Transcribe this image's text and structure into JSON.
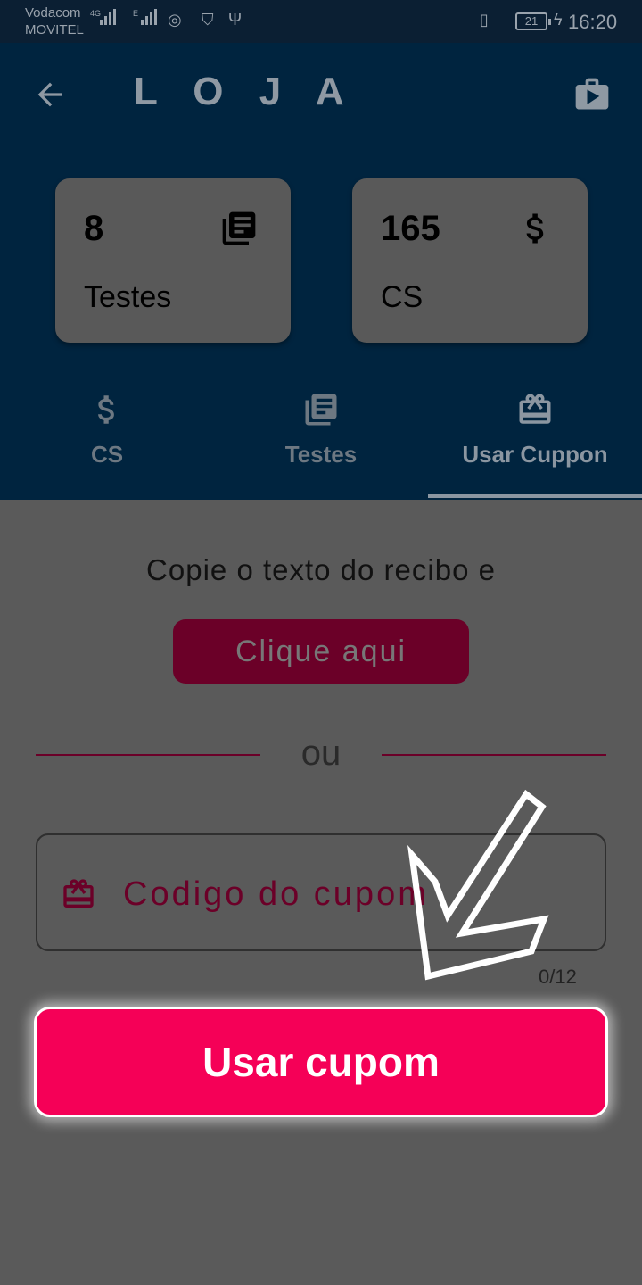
{
  "status_bar": {
    "carrier_1": "Vodacom",
    "carrier_2": "MOVITEL",
    "net_1": "4G",
    "net_2": "E",
    "battery": "21",
    "time": "16:20"
  },
  "header": {
    "title": "L O J A",
    "back_icon": "arrow-left-icon",
    "shop_icon": "shopping-bag-icon"
  },
  "cards": [
    {
      "value": "8",
      "label": "Testes",
      "icon": "library-books-icon"
    },
    {
      "value": "165",
      "label": "CS",
      "icon": "dollar-icon"
    }
  ],
  "tabs": [
    {
      "label": "CS",
      "icon": "dollar-icon",
      "active": false
    },
    {
      "label": "Testes",
      "icon": "library-books-icon",
      "active": false
    },
    {
      "label": "Usar Cuppon",
      "icon": "card-giftcard-icon",
      "active": true
    }
  ],
  "content": {
    "instruction": "Copie o texto do recibo e",
    "click_button": "Clique aqui",
    "divider_text": "ou",
    "coupon_placeholder": "Codigo do cupom",
    "coupon_value": "",
    "counter": "0/12",
    "submit_button": "Usar cupom"
  },
  "colors": {
    "header_bg": "#00243f",
    "accent": "#f50057",
    "dark_accent": "#6b0028",
    "overlay_bg": "#5a5a5a"
  }
}
